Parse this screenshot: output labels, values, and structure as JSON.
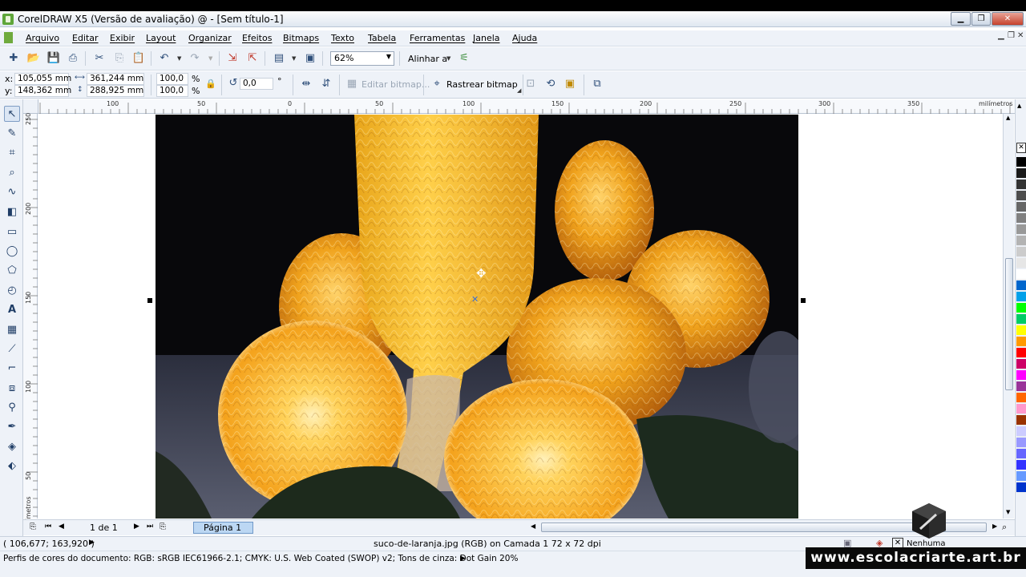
{
  "window": {
    "title": "CorelDRAW X5 (Versão de avaliação) @ - [Sem título-1]",
    "minimize": "▁",
    "restore": "❐",
    "close": "✕"
  },
  "menu": [
    "Arquivo",
    "Editar",
    "Exibir",
    "Layout",
    "Organizar",
    "Efeitos",
    "Bitmaps",
    "Texto",
    "Tabela",
    "Ferramentas",
    "Janela",
    "Ajuda"
  ],
  "toolbar": {
    "zoom": "62%",
    "align_label": "Alinhar a"
  },
  "property_bar": {
    "x_label": "x:",
    "x_value": "105,055 mm",
    "y_label": "y:",
    "y_value": "148,362 mm",
    "width_value": "361,244 mm",
    "height_value": "288,925 mm",
    "scale_x": "100,0",
    "scale_y": "100,0",
    "percent": "%",
    "rotation": "0,0",
    "degree": "°",
    "edit_bitmap": "Editar bitmap...",
    "trace_bitmap": "Rastrear bitmap"
  },
  "ruler": {
    "h_ticks": [
      "100",
      "50",
      "0",
      "50",
      "100",
      "150",
      "200",
      "250",
      "300",
      "350"
    ],
    "h_unit": "milímetros",
    "v_ticks": [
      "250",
      "200",
      "150",
      "100",
      "50"
    ],
    "v_unit": "milímetros"
  },
  "page_nav": {
    "page_count": "1 de 1",
    "page_tab": "Página 1"
  },
  "status": {
    "coords": "( 106,677; 163,920 )",
    "object_info": "suco-de-laranja.jpg (RGB) on Camada 1 72 x 72 dpi",
    "fill_none": "Nenhuma",
    "color_profiles": "Perfis de cores do documento: RGB: sRGB IEC61966-2.1; CMYK: U.S. Web Coated (SWOP) v2; Tons de cinza: Dot Gain 20%"
  },
  "watermark": "www.escolacriarte.art.br",
  "palette_colors": [
    "#000000",
    "#1a1a1a",
    "#333333",
    "#4d4d4d",
    "#666666",
    "#808080",
    "#999999",
    "#b3b3b3",
    "#cccccc",
    "#e6e6e6",
    "#ffffff",
    "#0066cc",
    "#00a0e9",
    "#00ff00",
    "#00cc66",
    "#ffff00",
    "#ff9900",
    "#ff0000",
    "#cc0066",
    "#ff00ff",
    "#993399",
    "#ff6600",
    "#ff99cc",
    "#993300",
    "#ccccff",
    "#9999ff",
    "#6666ff",
    "#3333ff",
    "#6699ff",
    "#0033cc"
  ]
}
